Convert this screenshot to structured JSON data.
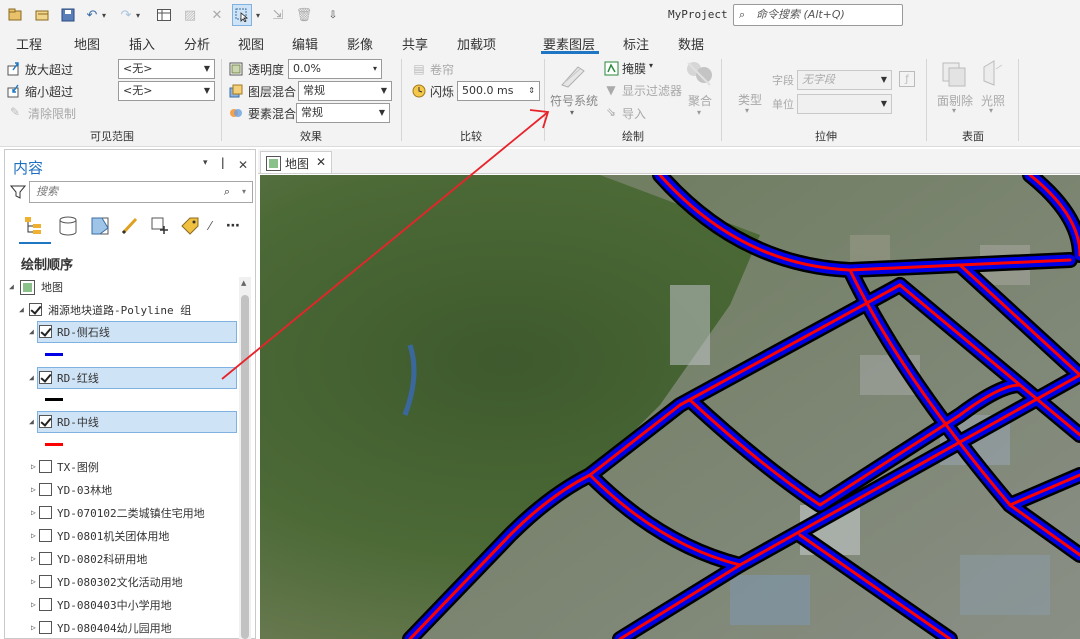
{
  "app": {
    "title": "MyProject",
    "command_search_placeholder": "命令搜索 (Alt+Q)"
  },
  "quick_access": [
    "new-icon",
    "open-icon",
    "save-icon",
    "undo-icon",
    "redo-icon",
    "table-icon",
    "edit-icon",
    "close-icon",
    "select-icon",
    "export-icon",
    "delete-icon",
    "customize-icon"
  ],
  "tabs": [
    {
      "label": "工程"
    },
    {
      "label": "地图"
    },
    {
      "label": "插入"
    },
    {
      "label": "分析"
    },
    {
      "label": "视图"
    },
    {
      "label": "编辑"
    },
    {
      "label": "影像"
    },
    {
      "label": "共享"
    },
    {
      "label": "加载项"
    },
    {
      "label": "要素图层",
      "active": true
    },
    {
      "label": "标注"
    },
    {
      "label": "数据"
    }
  ],
  "ribbon": {
    "visible_range": {
      "zoom_in_beyond": "放大超过",
      "zoom_out_beyond": "缩小超过",
      "clear_limits": "清除限制",
      "none_a": "<无>",
      "none_b": "<无>",
      "group_label": "可见范围"
    },
    "effects": {
      "transparency_label": "透明度",
      "transparency_value": "0.0%",
      "layer_blend_label": "图层混合",
      "layer_blend_value": "常规",
      "feature_blend_label": "要素混合",
      "feature_blend_value": "常规",
      "group_label": "效果"
    },
    "compare": {
      "swipe": "卷帘",
      "flicker": "闪烁",
      "flicker_value": "500.0  ms",
      "group_label": "比较"
    },
    "drawing": {
      "symbology": "符号系统",
      "mask": "掩膜",
      "display_filter": "显示过滤器",
      "import": "导入",
      "aggregate": "聚合",
      "group_label": "绘制"
    },
    "extrusion": {
      "type": "类型",
      "field_label": "字段",
      "field_placeholder": "无字段",
      "unit_label": "单位",
      "group_label": "拉伸"
    },
    "surface": {
      "face_culling": "面剔除",
      "lighting": "光照",
      "group_label": "表面"
    }
  },
  "contents": {
    "title": "内容",
    "search_placeholder": "搜索",
    "drawing_order": "绘制顺序",
    "map_node": "地图",
    "group_layer": "湘源地块道路-Polyline 组",
    "layers": [
      {
        "name": "RD-侧石线",
        "checked": true,
        "selected": true,
        "swatch": "#0000e6"
      },
      {
        "name": "RD-红线",
        "checked": true,
        "selected": true,
        "swatch": "#000000"
      },
      {
        "name": "RD-中线",
        "checked": true,
        "selected": true,
        "swatch": "#ff0000"
      }
    ],
    "other_layers": [
      "TX-图例",
      "YD-03林地",
      "YD-070102二类城镇住宅用地",
      "YD-0801机关团体用地",
      "YD-0802科研用地",
      "YD-080302文化活动用地",
      "YD-080403中小学用地",
      "YD-080404幼儿园用地"
    ]
  },
  "map_view": {
    "tab_label": "地图"
  },
  "colors": {
    "accent": "#1f76c2",
    "road_outline": "#000000",
    "road_fill": "#0000e6",
    "road_center": "#ff0000",
    "annotation_arrow": "#e8232a"
  }
}
